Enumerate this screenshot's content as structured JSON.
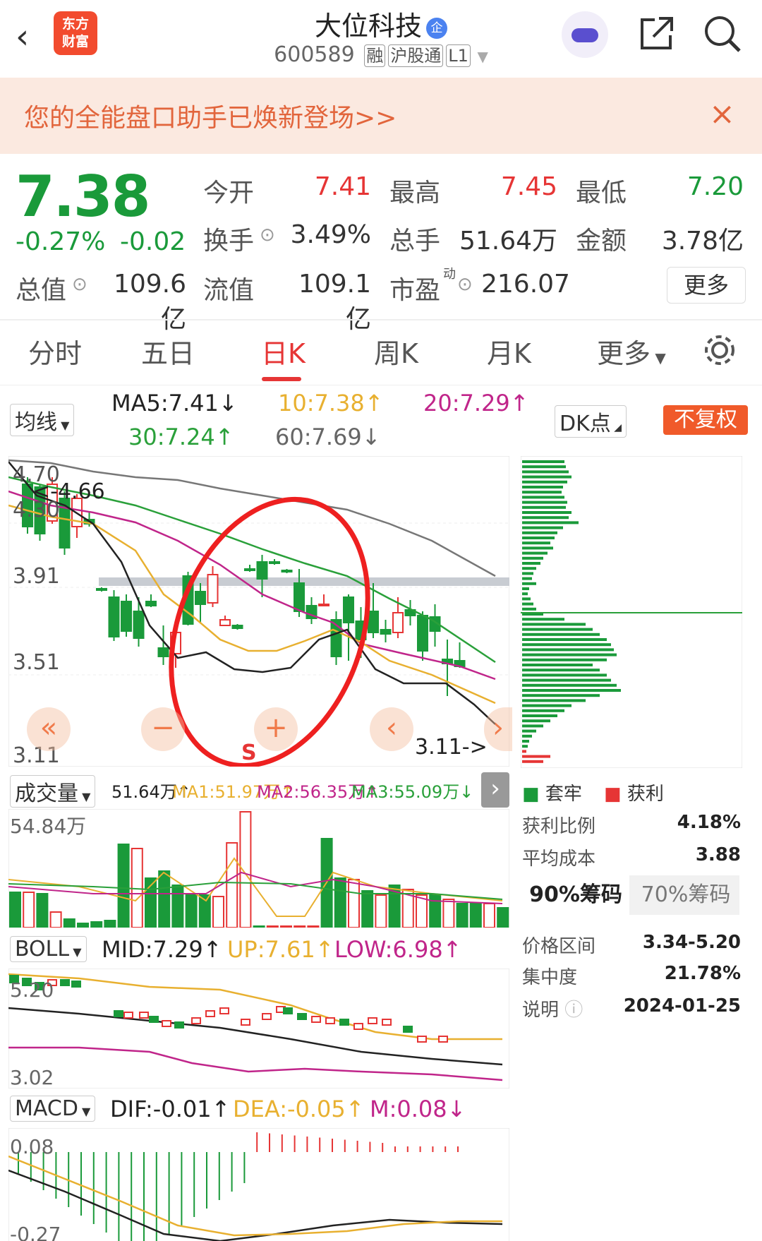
{
  "header": {
    "back": "‹",
    "logo_line1": "东方",
    "logo_line2": "财富",
    "name": "大位科技",
    "badge": "企",
    "code": "600589",
    "tags": [
      "融",
      "沪股通",
      "L1"
    ]
  },
  "banner": {
    "text": "您的全能盘口助手已焕新登场>>",
    "close": "×"
  },
  "quote": {
    "price": "7.38",
    "pct": "-0.27%",
    "chg": "-0.02",
    "open_label": "今开",
    "open": "7.41",
    "high_label": "最高",
    "high": "7.45",
    "low_label": "最低",
    "low": "7.20",
    "turnover_label": "换手",
    "turnover": "3.49%",
    "vol_label": "总手",
    "vol": "51.64万",
    "amount_label": "金额",
    "amount": "3.78亿",
    "mcap_label": "总值",
    "mcap": "109.6亿",
    "float_label": "流值",
    "float": "109.1亿",
    "pe_label": "市盈",
    "pe_sup": "动",
    "pe": "216.07",
    "more": "更多"
  },
  "tabs": [
    "分时",
    "五日",
    "日K",
    "周K",
    "月K",
    "更多"
  ],
  "active_tab": "日K",
  "ma_bar": {
    "select": "均线",
    "ma5": "MA5:7.41↓",
    "ma10": "10:7.38↑",
    "ma20": "20:7.29↑",
    "ma30": "30:7.24↑",
    "ma60": "60:7.69↓",
    "dk": "DK点",
    "fq": "不复权"
  },
  "kline": {
    "y_labels": [
      "4.70",
      "4.30",
      "3.91",
      "3.51",
      "3.11"
    ],
    "high_mark": "4.66",
    "low_mark": "3.11",
    "s_mark": "S"
  },
  "vol_bar": {
    "select": "成交量",
    "v": "51.64万↑",
    "ma1": "MA1:51.97万↑",
    "ma2": "MA2:56.35万↑",
    "ma3": "MA3:55.09万↓",
    "max_label": "54.84万"
  },
  "boll_bar": {
    "select": "BOLL",
    "mid": "MID:7.29↑",
    "up": "UP:7.61↑",
    "low": "LOW:6.98↑",
    "y_top": "5.20",
    "y_bot": "3.02"
  },
  "macd_bar": {
    "select": "MACD",
    "dif": "DIF:-0.01↑",
    "dea": "DEA:-0.05↑",
    "m": "M:0.08↓",
    "y_top": "0.08",
    "y_bot": "-0.27"
  },
  "chips": {
    "legend_trap": "套牢",
    "legend_profit": "获利",
    "profit_ratio_label": "获利比例",
    "profit_ratio": "4.18%",
    "avg_cost_label": "平均成本",
    "avg_cost": "3.88",
    "tab_90": "90%筹码",
    "tab_70": "70%筹码",
    "range_label": "价格区间",
    "range": "3.34-5.20",
    "conc_label": "集中度",
    "conc": "21.78%",
    "note_label": "说明",
    "note": "2024-01-25"
  },
  "colors": {
    "up": "#e63535",
    "down": "#1a9a3a",
    "ma5": "#222222",
    "ma10": "#e8b030",
    "ma20": "#c0258a",
    "ma30": "#2aa03a",
    "ma60": "#777777"
  }
}
